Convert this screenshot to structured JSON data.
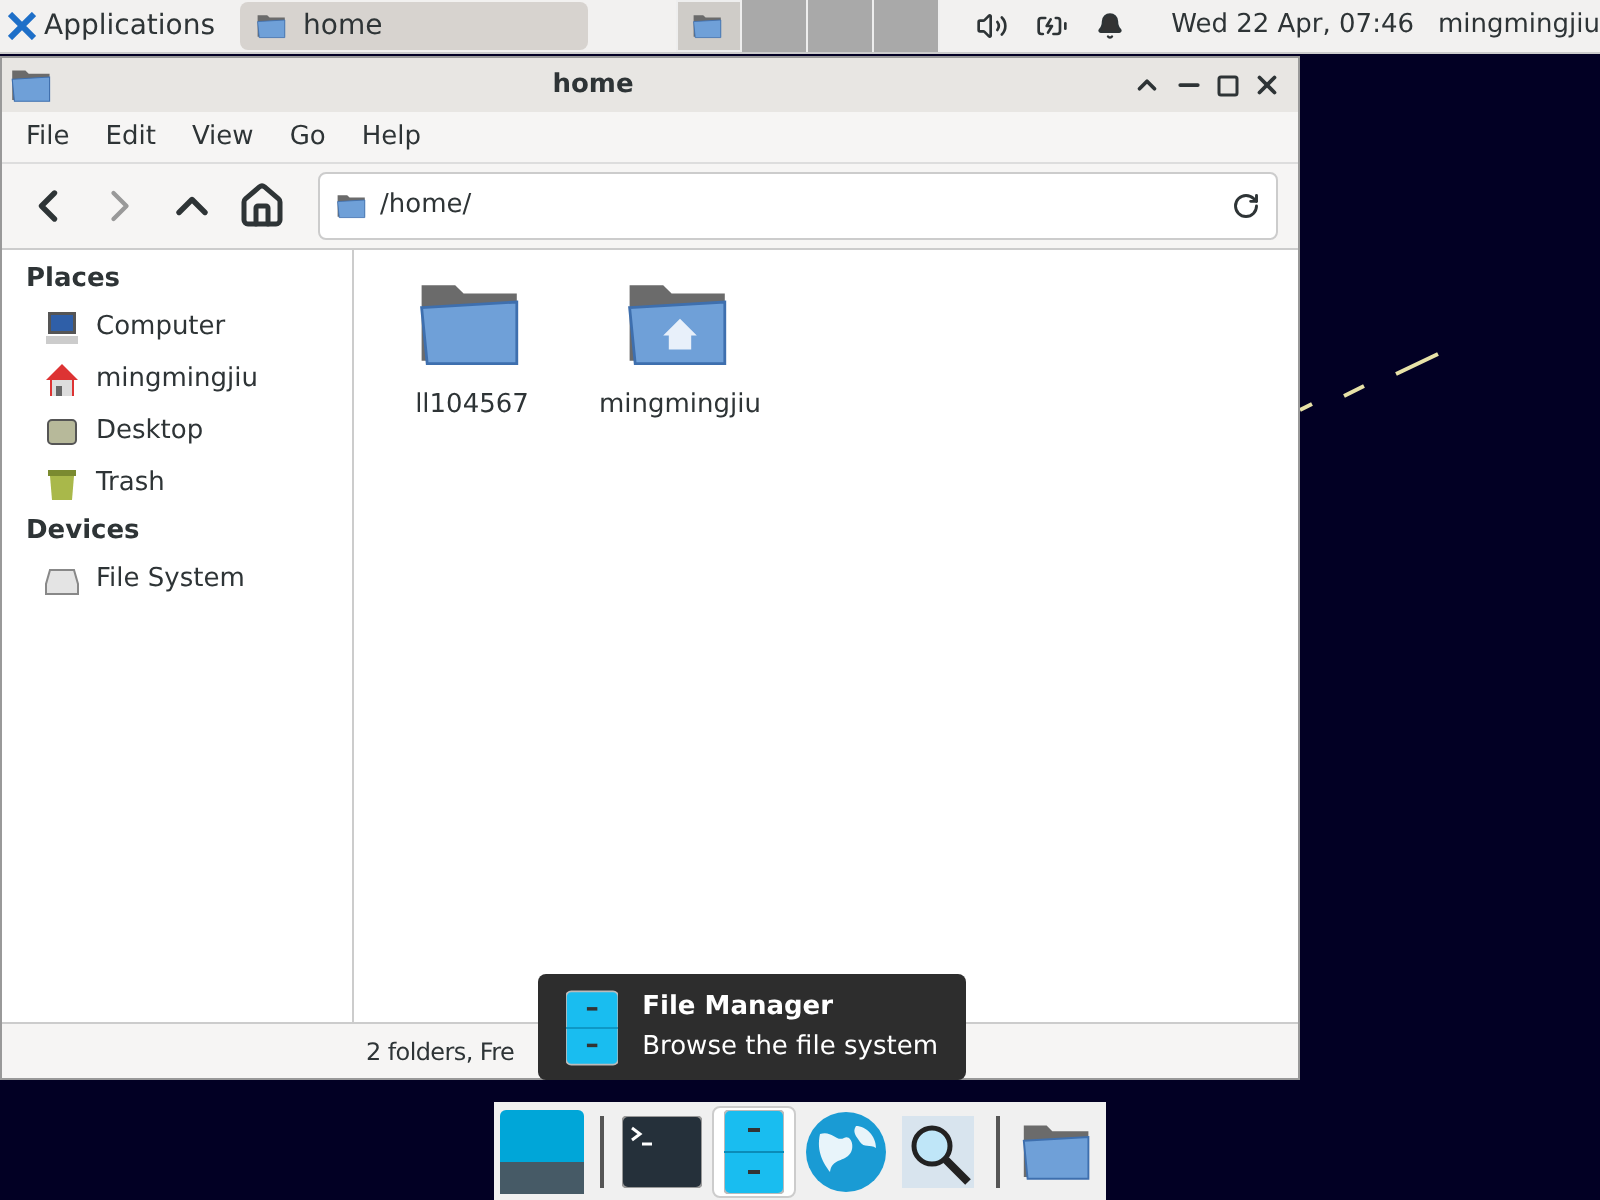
{
  "top_panel": {
    "apps_menu": "Applications",
    "tasks": [
      {
        "label": "home",
        "selected": true
      }
    ],
    "workspaces": [
      {
        "selected": true
      },
      {
        "selected": false
      },
      {
        "selected": false
      },
      {
        "selected": false
      }
    ],
    "clock": "Wed 22 Apr, 07:46",
    "user": "mingmingjiu"
  },
  "window": {
    "title": "home",
    "menu": [
      "File",
      "Edit",
      "View",
      "Go",
      "Help"
    ],
    "location": "/home/",
    "sidebar": [
      {
        "heading": "Places",
        "items": [
          {
            "label": "Computer",
            "kind": "computer"
          },
          {
            "label": "mingmingjiu",
            "kind": "home"
          },
          {
            "label": "Desktop",
            "kind": "desktop"
          },
          {
            "label": "Trash",
            "kind": "trash"
          }
        ]
      },
      {
        "heading": "Devices",
        "items": [
          {
            "label": "File System",
            "kind": "drive"
          }
        ]
      }
    ],
    "files": [
      {
        "name": "ll104567",
        "kind": "folder"
      },
      {
        "name": "mingmingjiu",
        "kind": "home"
      }
    ],
    "status": "2 folders, Fre"
  },
  "tooltip": {
    "title": "File Manager",
    "text": "Browse the file system"
  },
  "dock": [
    {
      "kind": "desktop",
      "selected": false
    },
    {
      "kind": "sep"
    },
    {
      "kind": "terminal",
      "selected": false
    },
    {
      "kind": "files",
      "selected": true
    },
    {
      "kind": "web",
      "selected": false
    },
    {
      "kind": "search",
      "selected": false
    },
    {
      "kind": "sep"
    },
    {
      "kind": "folder",
      "selected": false
    }
  ]
}
